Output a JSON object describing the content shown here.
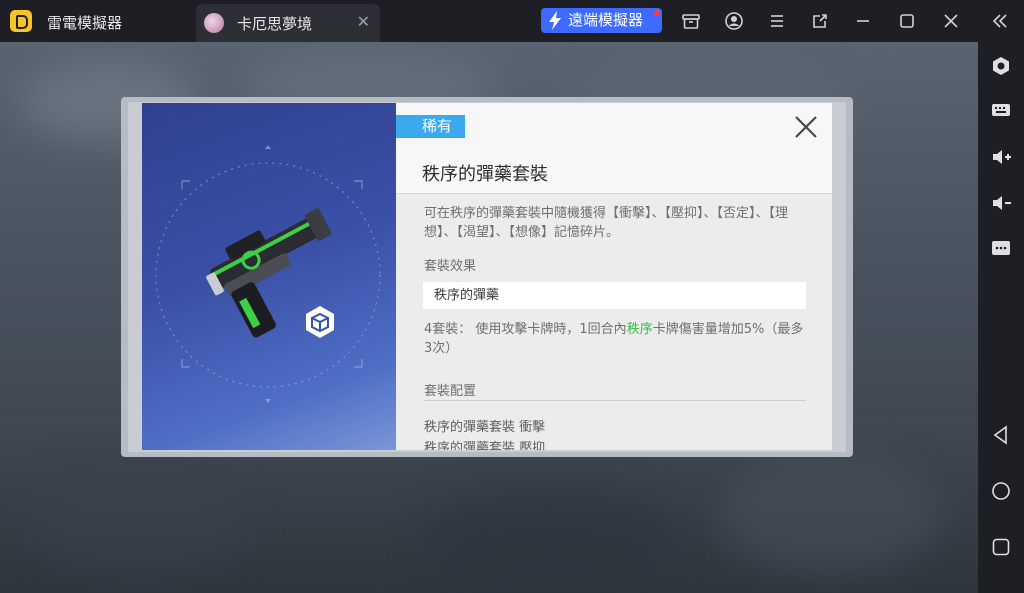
{
  "titlebar": {
    "app_title": "雷電模擬器",
    "tab_title": "卡厄思夢境",
    "tab_close": "✕",
    "remote_label": "遠端模擬器",
    "icons": [
      "store-icon",
      "account-icon",
      "menu-icon",
      "popout-icon",
      "minimize-icon",
      "maximize-icon",
      "close-icon",
      "collapse-sidebar-icon"
    ]
  },
  "sidebar": {
    "icons": [
      "settings-hex-icon",
      "keyboard-icon",
      "volume-up-icon",
      "volume-down-icon",
      "more-icon",
      "back-icon",
      "home-icon",
      "recents-icon"
    ]
  },
  "dialog": {
    "rarity": "稀有",
    "item_name": "秩序的彈藥套裝",
    "description": "可在秩序的彈藥套裝中隨機獲得【衝擊】、【壓抑】、【否定】、【理想】、【渴望】、【想像】記憶碎片。",
    "set_effect_heading": "套裝效果",
    "set_name": "秩序的彈藥",
    "effect": {
      "prefix": "4套裝： 使用攻擊卡牌時，1回合內",
      "highlight": "秩序",
      "suffix": "卡牌傷害量增加5%（最多3次）"
    },
    "config_heading": "套裝配置",
    "config_items": [
      "秩序的彈藥套裝 衝擊",
      "秩序的彈藥套裝 壓抑"
    ],
    "accent_color": "#3ba9ee",
    "highlight_color": "#2fbf3f"
  }
}
